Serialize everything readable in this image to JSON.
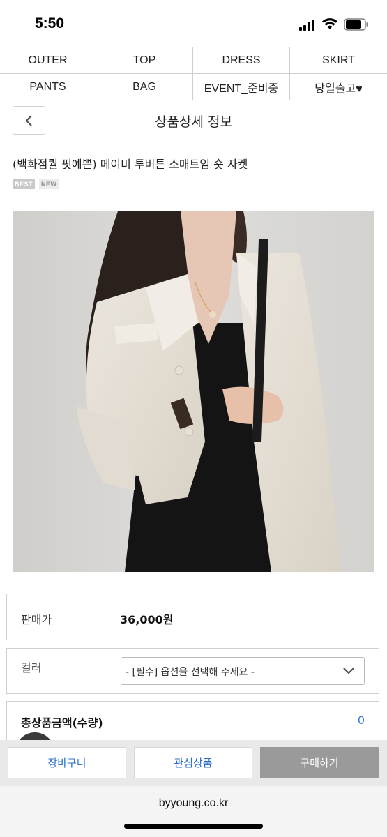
{
  "status": {
    "time": "5:50"
  },
  "categories": [
    "OUTER",
    "TOP",
    "DRESS",
    "SKIRT",
    "PANTS",
    "BAG",
    "EVENT_준비중",
    "당일출고♥"
  ],
  "header": {
    "title": "상품상세 정보"
  },
  "product": {
    "name": "(백화점퀄 핏예쁜) 메이비 투버튼 소매트임 숏 자켓",
    "badges": {
      "best": "BEST",
      "new": "NEW"
    },
    "price_label": "판매가",
    "price_value": "36,000원",
    "color_label": "컬러",
    "color_select_value": "- [필수] 옵션을 선택해 주세요 -",
    "total_label": "총상품금액(수량)",
    "total_count": "0"
  },
  "actions": {
    "cart": "장바구니",
    "wishlist": "관심상품",
    "buy": "구매하기"
  },
  "browser": {
    "url": "byyoung.co.kr"
  },
  "colors": {
    "accent_blue": "#2c6fc9",
    "buy_button": "#9a9a9a",
    "border": "#cfcfcf"
  }
}
